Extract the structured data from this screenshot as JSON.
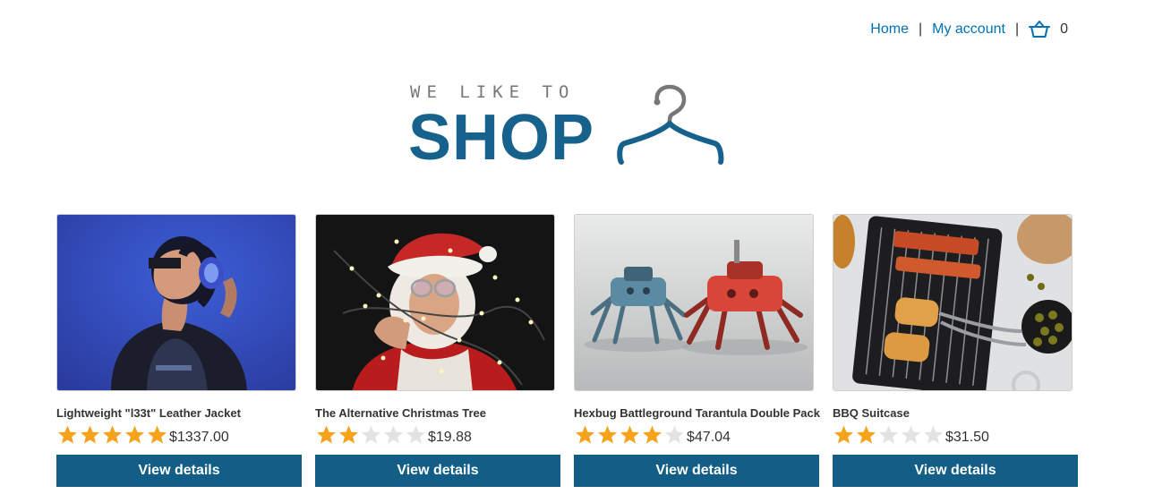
{
  "nav": {
    "home": "Home",
    "separator": "|",
    "my_account": "My account",
    "cart_icon": "basket-icon",
    "cart_count": "0",
    "link_color": "#0071b3"
  },
  "logo": {
    "tagline": "WE LIKE TO",
    "word": "SHOP",
    "icon": "hanger-icon",
    "color": "#17628d"
  },
  "products": [
    {
      "name": "Lightweight \"l33t\" Leather Jacket",
      "rating": 5,
      "price": "$1337.00",
      "button": "View details",
      "image": "woman-headphones-photo"
    },
    {
      "name": "The Alternative Christmas Tree",
      "rating": 2,
      "price": "$19.88",
      "button": "View details",
      "image": "man-in-santa-hat-with-lights-photo"
    },
    {
      "name": "Hexbug Battleground Tarantula Double Pack",
      "rating": 4,
      "price": "$47.04",
      "button": "View details",
      "image": "robot-spiders-photo"
    },
    {
      "name": "BBQ Suitcase",
      "rating": 2,
      "price": "$31.50",
      "button": "View details",
      "image": "bbq-grill-photo"
    }
  ],
  "colors": {
    "button_bg": "#135e86",
    "star_on": "#f7a21b",
    "star_off": "#e3e3e3"
  }
}
